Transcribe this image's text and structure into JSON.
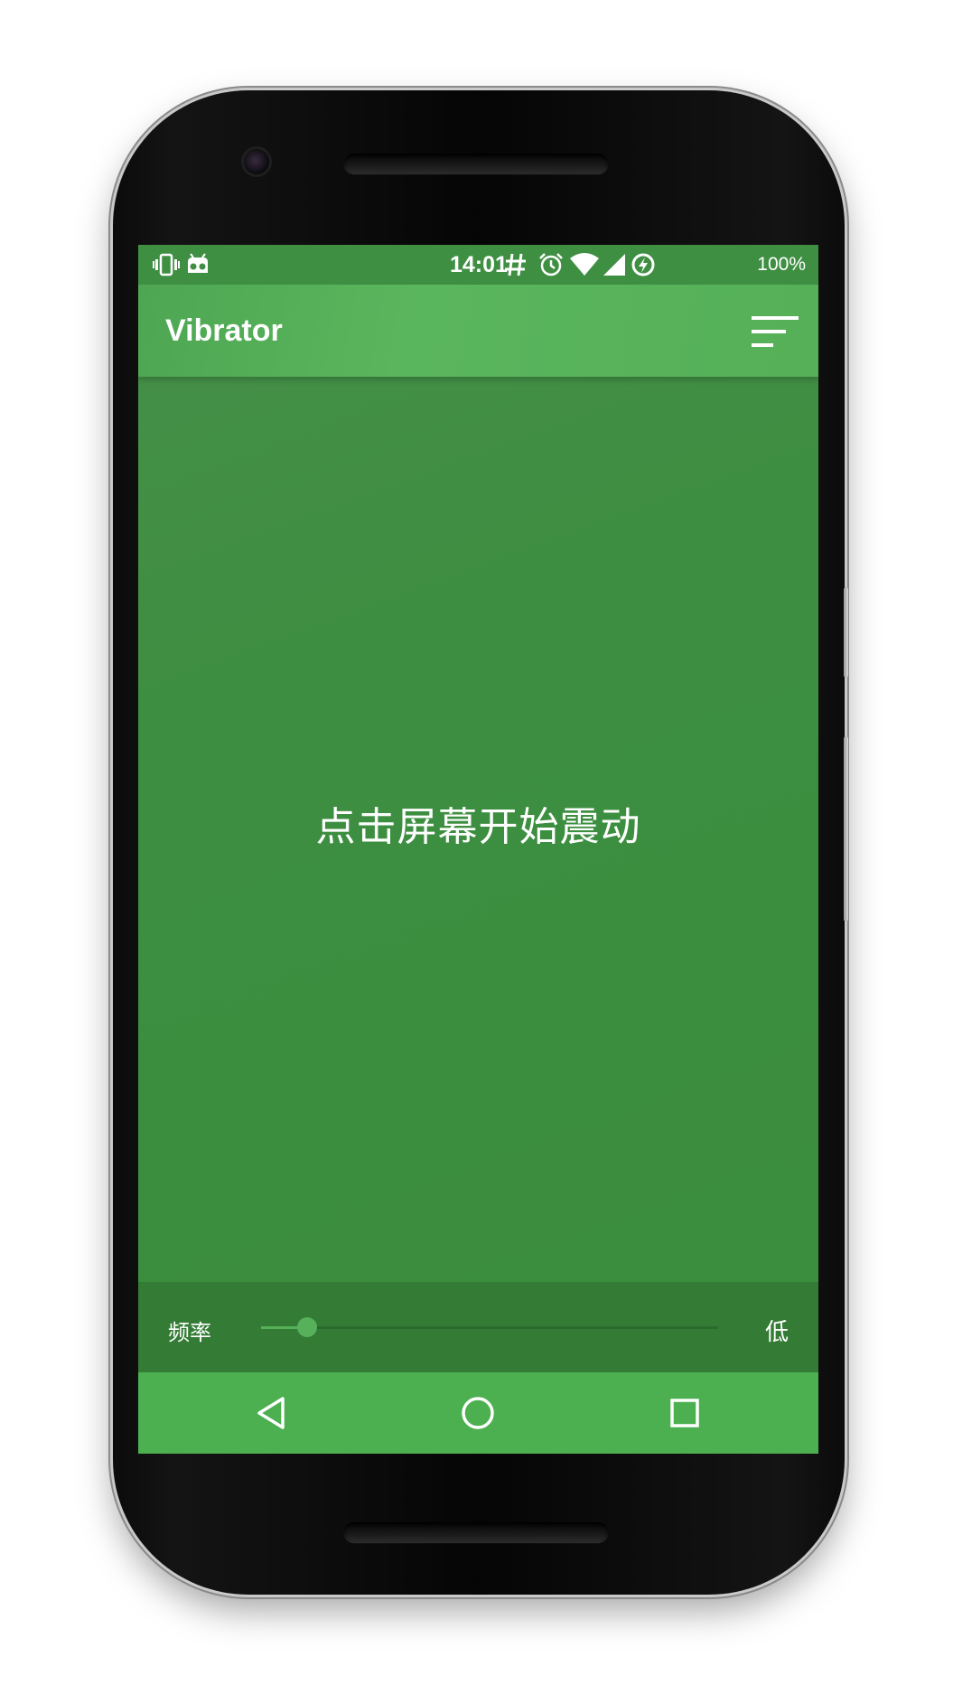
{
  "status_bar": {
    "time": "14:01",
    "battery_percent": "100%",
    "left_icons": [
      "vibrate-icon",
      "android-debug-icon"
    ],
    "right_icons": [
      "hash-icon",
      "alarm-icon",
      "wifi-icon",
      "signal-icon",
      "battery-charging-icon"
    ]
  },
  "app_bar": {
    "title": "Vibrator",
    "action_icon": "sort-filter-icon"
  },
  "main": {
    "tap_hint": "点击屏幕开始震动"
  },
  "frequency": {
    "label": "频率",
    "value_label": "低",
    "level": 0.1
  },
  "nav_bar": {
    "buttons": [
      "back-icon",
      "home-icon",
      "recents-icon"
    ]
  },
  "colors": {
    "primary": "#4caf50",
    "app_bar": "#55b058",
    "content": "#3b8e3e",
    "status_bar": "#3f8f43",
    "frequency_bar": "#347c36"
  }
}
